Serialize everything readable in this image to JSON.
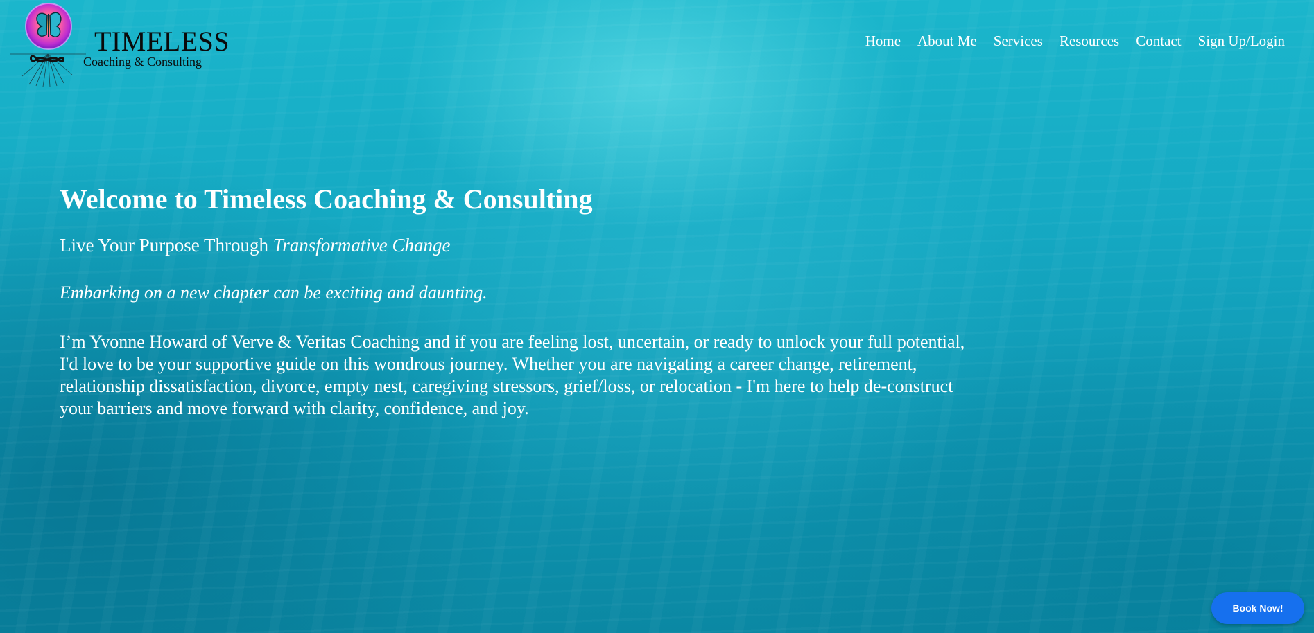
{
  "brand": {
    "title": "TIMELESS",
    "subtitle": "Coaching & Consulting",
    "logo_icon": "butterfly-infinity-icon"
  },
  "nav": {
    "items": [
      {
        "label": "Home"
      },
      {
        "label": "About Me"
      },
      {
        "label": "Services"
      },
      {
        "label": "Resources"
      },
      {
        "label": "Contact"
      },
      {
        "label": "Sign Up/Login"
      }
    ]
  },
  "hero": {
    "heading": "Welcome to Timeless Coaching & Consulting",
    "tagline_plain": "Live Your Purpose Through ",
    "tagline_italic": "Transformative Change",
    "lead": "Embarking on a new chapter can be exciting and daunting.",
    "body": "I’m Yvonne Howard of Verve & Veritas Coaching and if you are feeling lost, uncertain, or ready to unlock your full potential, I'd love to be your supportive guide on this wondrous journey. Whether you are navigating a career change, retirement, relationship dissatisfaction, divorce, empty nest, caregiving stressors, grief/loss, or relocation - I'm here to help de-construct your barriers and move forward with clarity, confidence, and joy."
  },
  "cta": {
    "book_label": "Book Now!"
  },
  "colors": {
    "background": "#15a9c3",
    "button": "#1670ee",
    "text": "#ffffff",
    "logo_text": "#0a0a0a"
  }
}
